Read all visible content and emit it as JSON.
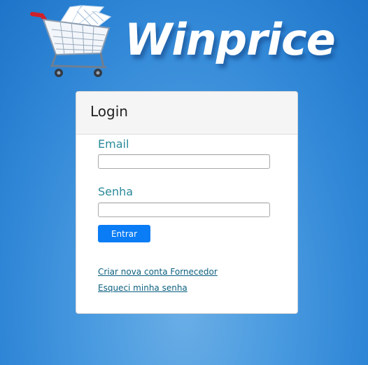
{
  "brand": {
    "name": "Winprice",
    "cart_icon": "shopping-cart-icon"
  },
  "login": {
    "title": "Login",
    "email_label": "Email",
    "email_value": "",
    "password_label": "Senha",
    "password_value": "",
    "submit_label": "Entrar",
    "create_account_link": "Criar nova conta Fornecedor",
    "forgot_password_link": "Esqueci minha senha"
  },
  "colors": {
    "background": "#2f86d6",
    "button": "#0a7cf5",
    "label": "#2a8a9a",
    "link": "#0b5f80"
  }
}
